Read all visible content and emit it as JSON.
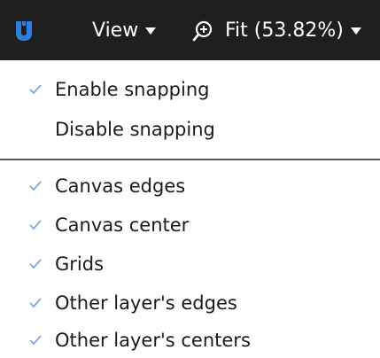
{
  "toolbar": {
    "view_label": "View",
    "zoom_label": "Fit (53.82%)",
    "colors": {
      "background": "#1f1f1f",
      "logo": "#2f7fe0"
    },
    "icons": {
      "logo": "u-logo-icon",
      "zoom": "zoom-in-icon",
      "caret": "caret-down-icon"
    }
  },
  "menu": {
    "check_color": "#7aa7de",
    "snapping": [
      {
        "label": "Enable snapping",
        "checked": true
      },
      {
        "label": "Disable snapping",
        "checked": false
      }
    ],
    "targets": [
      {
        "label": "Canvas edges",
        "checked": true
      },
      {
        "label": "Canvas center",
        "checked": true
      },
      {
        "label": "Grids",
        "checked": true
      },
      {
        "label": "Other layer's edges",
        "checked": true
      },
      {
        "label": "Other layer's centers",
        "checked": true
      }
    ]
  }
}
